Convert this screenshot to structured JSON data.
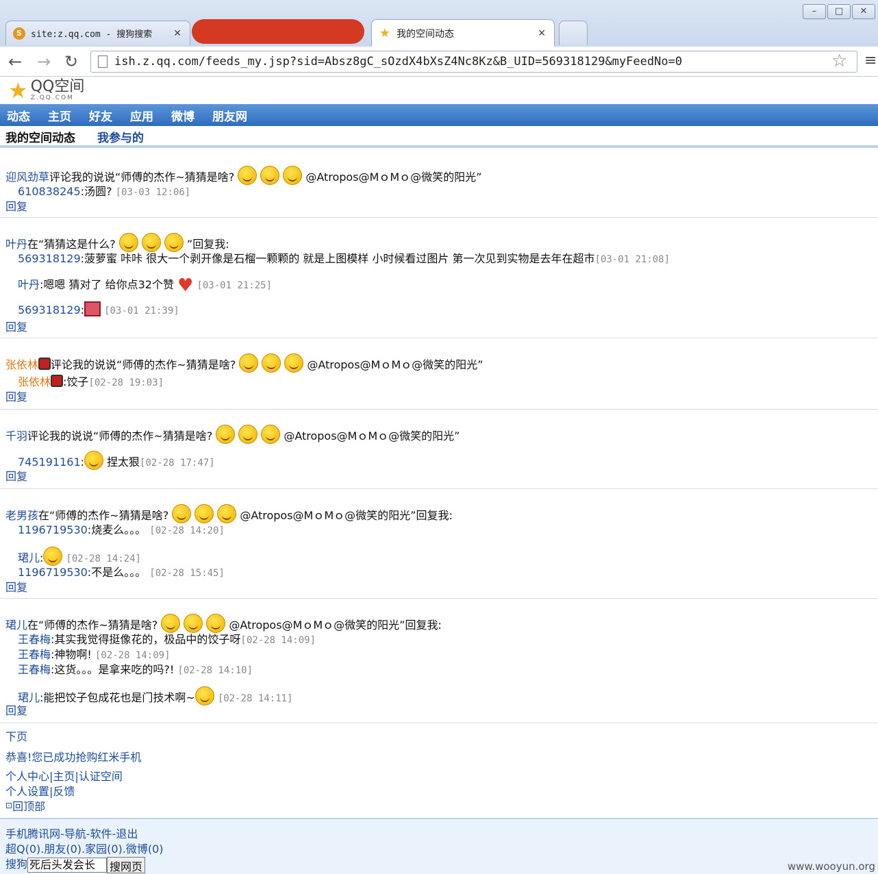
{
  "browser": {
    "tabs": [
      {
        "label": "site:z.qq.com - 搜狗搜索"
      },
      {
        "label": "我的空间动态"
      }
    ],
    "url": "ish.z.qq.com/feeds_my.jsp?sid=Absz8gC_sOzdX4bXsZ4Nc8Kz&B_UID=569318129&myFeedNo=0",
    "win_controls": [
      "–",
      "□",
      "✕"
    ]
  },
  "logo": {
    "text": "QQ空间",
    "sub": "Z.QQ.COM"
  },
  "navbar": [
    "动态",
    "主页",
    "好友",
    "应用",
    "微博",
    "朋友网"
  ],
  "subnav": {
    "current": "我的空间动态",
    "other": "我参与的"
  },
  "feeds": [
    {
      "head_user": "迎风劲草",
      "head_text": "评论我的说说“师傅的杰作~猜猜是啥?",
      "head_tail": "@Atropos@MｏMｏ@微笑的阳光”",
      "replies": [
        {
          "user": "610838245",
          "text": ":汤圆?",
          "time": "[03-03 12:06]"
        }
      ],
      "reply_link": "回复"
    },
    {
      "head_user": "叶丹",
      "head_text": "在“猜猜这是什么?",
      "head_tail": "”回复我:",
      "replies": [
        {
          "user": "569318129",
          "text": ":菠萝蜜 咔咔 很大一个剥开像是石榴一颗颗的 就是上图模样 小时候看过图片 第一次见到实物是去年在超市",
          "time": "[03-01 21:08]"
        },
        {
          "user": "叶丹",
          "text": ":嗯嗯 猜对了 给你点32个赞",
          "time": "[03-01 21:25]"
        },
        {
          "user": "569318129",
          "text": ":",
          "time": "[03-01 21:39]"
        }
      ],
      "reply_link": "回复"
    },
    {
      "head_user": "张依林",
      "head_text": "评论我的说说“师傅的杰作~猜猜是啥?",
      "head_tail": "@Atropos@MｏMｏ@微笑的阳光”",
      "replies": [
        {
          "user": "张依林",
          "text": ":饺子",
          "time": "[02-28 19:03]"
        }
      ],
      "reply_link": "回复"
    },
    {
      "head_user": "千羽",
      "head_text": "评论我的说说“师傅的杰作~猜猜是啥?",
      "head_tail": "@Atropos@MｏMｏ@微笑的阳光”",
      "replies": [
        {
          "user": "745191161",
          "text": ":",
          "text2": "捏太狠",
          "time": "[02-28 17:47]"
        }
      ],
      "reply_link": "回复"
    },
    {
      "head_user": "老男孩",
      "head_text": "在“师傅的杰作~猜猜是啥?",
      "head_tail": "@Atropos@MｏMｏ@微笑的阳光”回复我:",
      "replies": [
        {
          "user": "1196719530",
          "text": ":烧麦么。。。",
          "time": "[02-28 14:20]"
        },
        {
          "user": "珺儿",
          "text": ":",
          "time": "[02-28 14:24]"
        },
        {
          "user": "1196719530",
          "text": ":不是么。。。",
          "time": "[02-28 15:45]"
        }
      ],
      "reply_link": "回复"
    },
    {
      "head_user": "珺儿",
      "head_text": "在“师傅的杰作~猜猜是啥?",
      "head_tail": "@Atropos@MｏMｏ@微笑的阳光”回复我:",
      "replies": [
        {
          "user": "王春梅",
          "text": ":其实我觉得挺像花的，极品中的饺子呀",
          "time": "[02-28 14:09]"
        },
        {
          "user": "王春梅",
          "text": ":神物啊!",
          "time": "[02-28 14:09]"
        },
        {
          "user": "王春梅",
          "text": ":这货。。。是拿来吃的吗?!",
          "time": "[02-28 14:10]"
        },
        {
          "user": "珺儿",
          "text": ":能把饺子包成花也是门技术啊~",
          "time": "[02-28 14:11]"
        }
      ],
      "reply_link": "回复"
    }
  ],
  "footer": {
    "next_page": "下页",
    "promo": "恭喜!您已成功抢购红米手机",
    "links1": [
      "个人中心",
      "主页",
      "认证空间"
    ],
    "links2": [
      "个人设置",
      "反馈"
    ],
    "back_top": "回顶部",
    "band_line1": "手机腾讯网-导航-软件-退出",
    "band_line2": "超Q(0).朋友(0).家园(0).微博(0)",
    "search_label": "搜狗",
    "search_value": "死后头发会长",
    "search_button": "搜网页"
  },
  "watermark": "www.wooyun.org"
}
